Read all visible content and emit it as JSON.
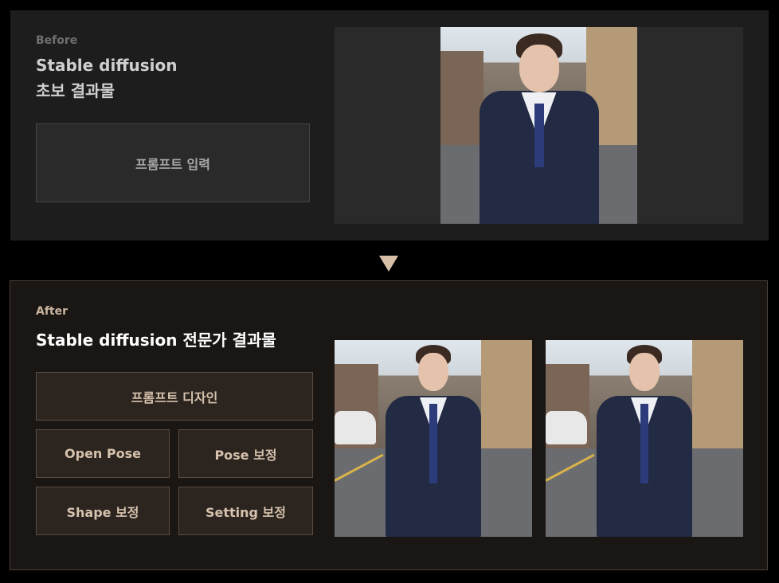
{
  "before": {
    "tag": "Before",
    "title_line1": "Stable diffusion",
    "title_line2": "초보 결과물",
    "prompt_button": "프롬프트 입력"
  },
  "after": {
    "tag": "After",
    "title": "Stable diffusion 전문가 결과물",
    "buttons": {
      "prompt_design": "프롬프트 디자인",
      "open_pose": "Open Pose",
      "pose_fix": "Pose 보정",
      "shape_fix": "Shape 보정",
      "setting_fix": "Setting 보정"
    }
  },
  "colors": {
    "accent": "#d7bfa6",
    "after_border": "#4b3f36",
    "before_panel": "#1d1d1d",
    "after_panel": "#1a1614"
  }
}
